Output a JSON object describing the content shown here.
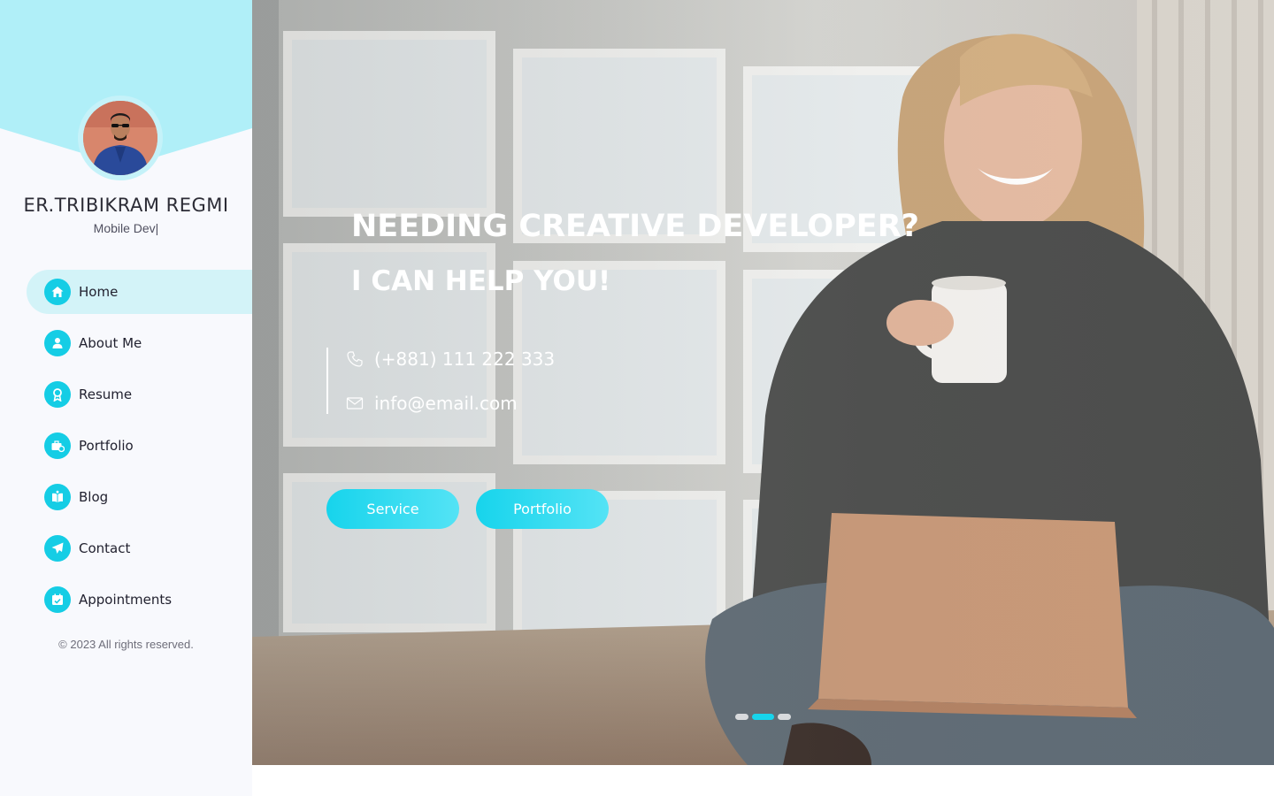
{
  "sidebar": {
    "name": "ER.TRIBIKRAM REGMI",
    "role": "Mobile Dev|",
    "items": [
      {
        "label": "Home",
        "icon": "home-icon",
        "active": true
      },
      {
        "label": "About Me",
        "icon": "user-icon"
      },
      {
        "label": "Resume",
        "icon": "award-icon"
      },
      {
        "label": "Portfolio",
        "icon": "briefcase-icon"
      },
      {
        "label": "Blog",
        "icon": "book-icon"
      },
      {
        "label": "Contact",
        "icon": "paper-plane-icon"
      },
      {
        "label": "Appointments",
        "icon": "calendar-check-icon"
      }
    ],
    "copyright": "© 2023 All rights reserved."
  },
  "hero": {
    "title": "NEEDING CREATIVE DEVELOPER?",
    "subtitle": "I CAN HELP YOU!",
    "phone": "(+881) 111 222 333",
    "email": "info@email.com",
    "buttons": {
      "service": "Service",
      "portfolio": "Portfolio"
    },
    "slider": {
      "count": 3,
      "active_index": 1
    }
  },
  "colors": {
    "accent": "#15cde5",
    "sidebar_bg": "#f8f9fd",
    "header_wave": "#b0eff8",
    "active_item_bg": "#d3f3f8"
  }
}
